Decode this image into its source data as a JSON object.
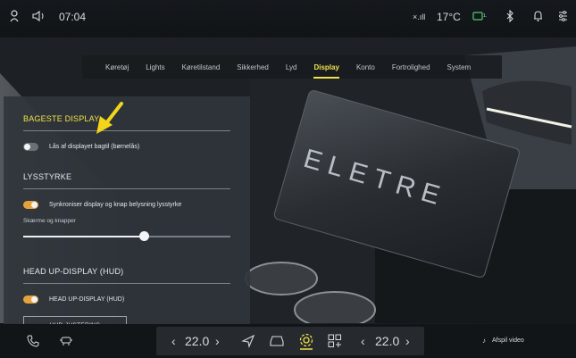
{
  "status": {
    "time": "07:04",
    "signal_label": "×.ıll",
    "temperature": "17°C",
    "icons": [
      "person-icon",
      "volume-icon",
      "signal-icon",
      "cloud-icon",
      "bluetooth-icon",
      "bell-icon",
      "settings-sliders-icon"
    ]
  },
  "tabs": [
    {
      "label": "Køretøj",
      "active": false
    },
    {
      "label": "Lights",
      "active": false
    },
    {
      "label": "Køretilstand",
      "active": false
    },
    {
      "label": "Sikkerhed",
      "active": false
    },
    {
      "label": "Lyd",
      "active": false
    },
    {
      "label": "Display",
      "active": true
    },
    {
      "label": "Konto",
      "active": false
    },
    {
      "label": "Fortrolighed",
      "active": false
    },
    {
      "label": "System",
      "active": false
    }
  ],
  "panel": {
    "rear_display": {
      "title": "BAGESTE DISPLAY",
      "child_lock": {
        "label": "Lås af displayet bagtil (børnelås)",
        "on": false
      }
    },
    "brightness": {
      "title": "LYSSTYRKE",
      "sync": {
        "label": "Synkroniser display og knap belysning lysstyrke",
        "on": true
      },
      "slider_label": "Skærme og knapper",
      "slider_value": 0.58
    },
    "hud": {
      "title": "HEAD UP-DISPLAY (HUD)",
      "toggle": {
        "label": "HEAD UP-DISPLAY (HUD)",
        "on": true
      },
      "adjust_button": "HUD-JUSTERING"
    }
  },
  "bottom": {
    "left_temp": "22.0",
    "right_temp": "22.0",
    "media_label": "Afspil video"
  },
  "colors": {
    "accent": "#f0e04a",
    "toggle_on": "#e5a23c",
    "annotation_arrow": "#f3d51a"
  }
}
